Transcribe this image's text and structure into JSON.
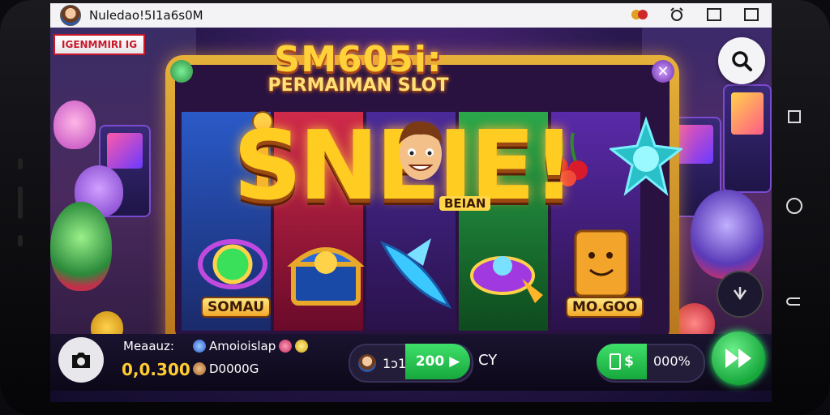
{
  "status_bar": {
    "title": "Nuledao!5I1a6s0M",
    "icons": [
      "notification-icon",
      "alarm-icon",
      "window-icon",
      "cast-icon"
    ]
  },
  "top_badge": {
    "label": "IGENMMIRI IG"
  },
  "machine": {
    "title": "SM605i:",
    "subtitle": "PERMAIMAN SLOT",
    "banner": "SNEIE!",
    "face_label": "BEIAN",
    "symbols": [
      {
        "name": "soma-gem",
        "label": "SOMAU"
      },
      {
        "name": "treasure-chest",
        "label": ""
      },
      {
        "name": "rocket-fish",
        "label": ""
      },
      {
        "name": "ufo-ring",
        "label": ""
      },
      {
        "name": "golden-cookie",
        "label": "MO.GOO"
      }
    ],
    "reel_colors": [
      "#1d3d8a",
      "#a51a3a",
      "#3a1a6a",
      "#1c7a2e",
      "#3a1a6a"
    ]
  },
  "hud": {
    "balance_label": "Meaauz:",
    "balance_value": "0,0.300",
    "player_name": "Amoioislap",
    "coins": "D0000G",
    "bet_count": "1ɔ1",
    "bet_value": "200",
    "currency": "CY",
    "win_value": "$",
    "win_percent": "000%"
  },
  "colors": {
    "accent_gold": "#ffcc22",
    "accent_green": "#2ad45a",
    "badge_red": "#c81828"
  }
}
